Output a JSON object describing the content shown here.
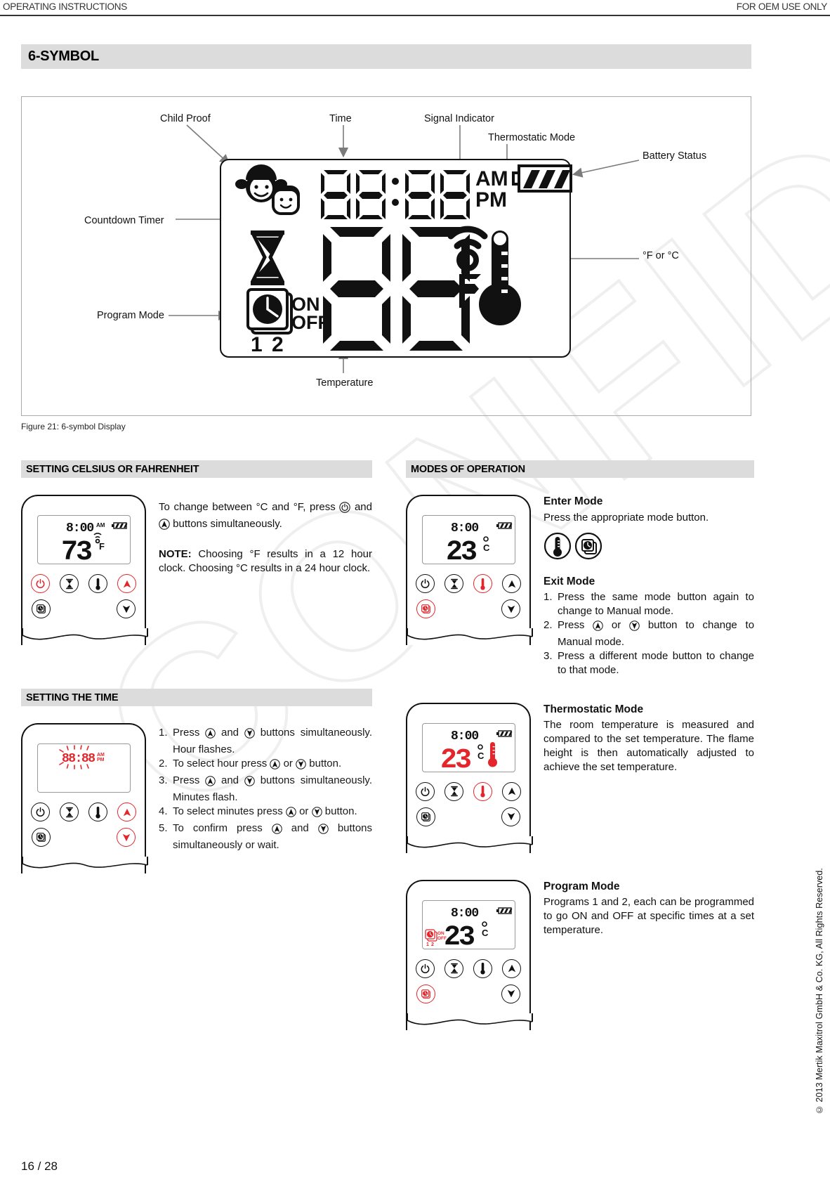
{
  "header": {
    "left": "OPERATING INSTRUCTIONS",
    "right": "FOR OEM USE ONLY"
  },
  "main_title": "6-SYMBOL",
  "figure": {
    "caption": "Figure 21: 6-symbol Display",
    "callouts": {
      "child_proof": "Child Proof",
      "time": "Time",
      "signal_indicator": "Signal Indicator",
      "thermostatic_mode": "Thermostatic Mode",
      "battery_status": "Battery Status",
      "countdown_timer": "Countdown Timer",
      "program_mode": "Program Mode",
      "temperature": "Temperature",
      "units": "°F or °C"
    },
    "lcd": {
      "time_value": "88:88",
      "am": "AM",
      "pm": "PM",
      "on": "ON",
      "off": "OFF",
      "program_1": "1",
      "program_2": "2",
      "temperature_value": "88",
      "unit_letter": "F"
    }
  },
  "sections": {
    "celsius_fahrenheit": {
      "title": "SETTING CELSIUS OR FAHRENHEIT",
      "paragraph_before_icon": "To change between °C and °F, press",
      "paragraph_middle": "and",
      "paragraph_after": "buttons simultaneously.",
      "note_label": "NOTE:",
      "note_text": "Choosing °F results in a 12 hour clock. Choosing °C results in a 24 hour clock.",
      "device": {
        "time_value": "8:00",
        "am": "AM",
        "temperature_value": "73",
        "unit_letter": "F"
      }
    },
    "setting_time": {
      "title": "SETTING THE TIME",
      "steps": [
        {
          "num": "1.",
          "text_a": "Press",
          "text_b": "and",
          "text_c": "buttons simultaneously. Hour flashes."
        },
        {
          "num": "2.",
          "text_a": "To select hour press",
          "text_b": "or",
          "text_c": "button."
        },
        {
          "num": "3.",
          "text_a": "Press",
          "text_b": "and",
          "text_c": "buttons simultaneously. Minutes flash."
        },
        {
          "num": "4.",
          "text_a": "To select minutes press",
          "text_b": "or",
          "text_c": "button."
        },
        {
          "num": "5.",
          "text_a": "To confirm press",
          "text_b": "and",
          "text_c": "buttons simultaneously or wait."
        }
      ],
      "device": {
        "time_value": "88:88",
        "am": "AM",
        "pm": "PM"
      }
    },
    "modes_of_operation": {
      "title": "MODES OF OPERATION",
      "enter_mode": {
        "heading": "Enter Mode",
        "text": "Press the appropriate mode button."
      },
      "exit_mode": {
        "heading": "Exit Mode",
        "steps": [
          {
            "num": "1.",
            "text": "Press the same mode button again to change to Manual mode."
          },
          {
            "num": "2.",
            "text_a": "Press",
            "text_b": "or",
            "text_c": "button to change to Manual mode."
          },
          {
            "num": "3.",
            "text": "Press a different mode button to change to that mode."
          }
        ]
      },
      "thermostatic_mode": {
        "heading": "Thermostatic Mode",
        "text": "The room temperature is measured and compared to the set temperature. The flame height is then automatically adjusted to achieve the set temperature.",
        "device": {
          "time_value": "8:00",
          "temperature_value": "23",
          "unit_letter": "C"
        }
      },
      "program_mode": {
        "heading": "Program Mode",
        "text": "Programs 1 and 2, each can be programmed to go ON and OFF at specific times at a set temperature.",
        "device": {
          "time_value": "8:00",
          "temperature_value": "23",
          "unit_letter": "C",
          "on": "ON",
          "off": "OFF",
          "program_1": "1",
          "program_2": "2"
        }
      },
      "mode_device": {
        "time_value": "8:00",
        "temperature_value": "23",
        "unit_letter": "C"
      }
    }
  },
  "footer": {
    "copyright": "© 2013 Mertik Maxitrol GmbH & Co. KG, All Rights Reserved.",
    "page": "16 / 28"
  },
  "colors": {
    "accent_red": "#e3262b",
    "band_gray": "#dcdcdc",
    "ink": "#111111"
  }
}
